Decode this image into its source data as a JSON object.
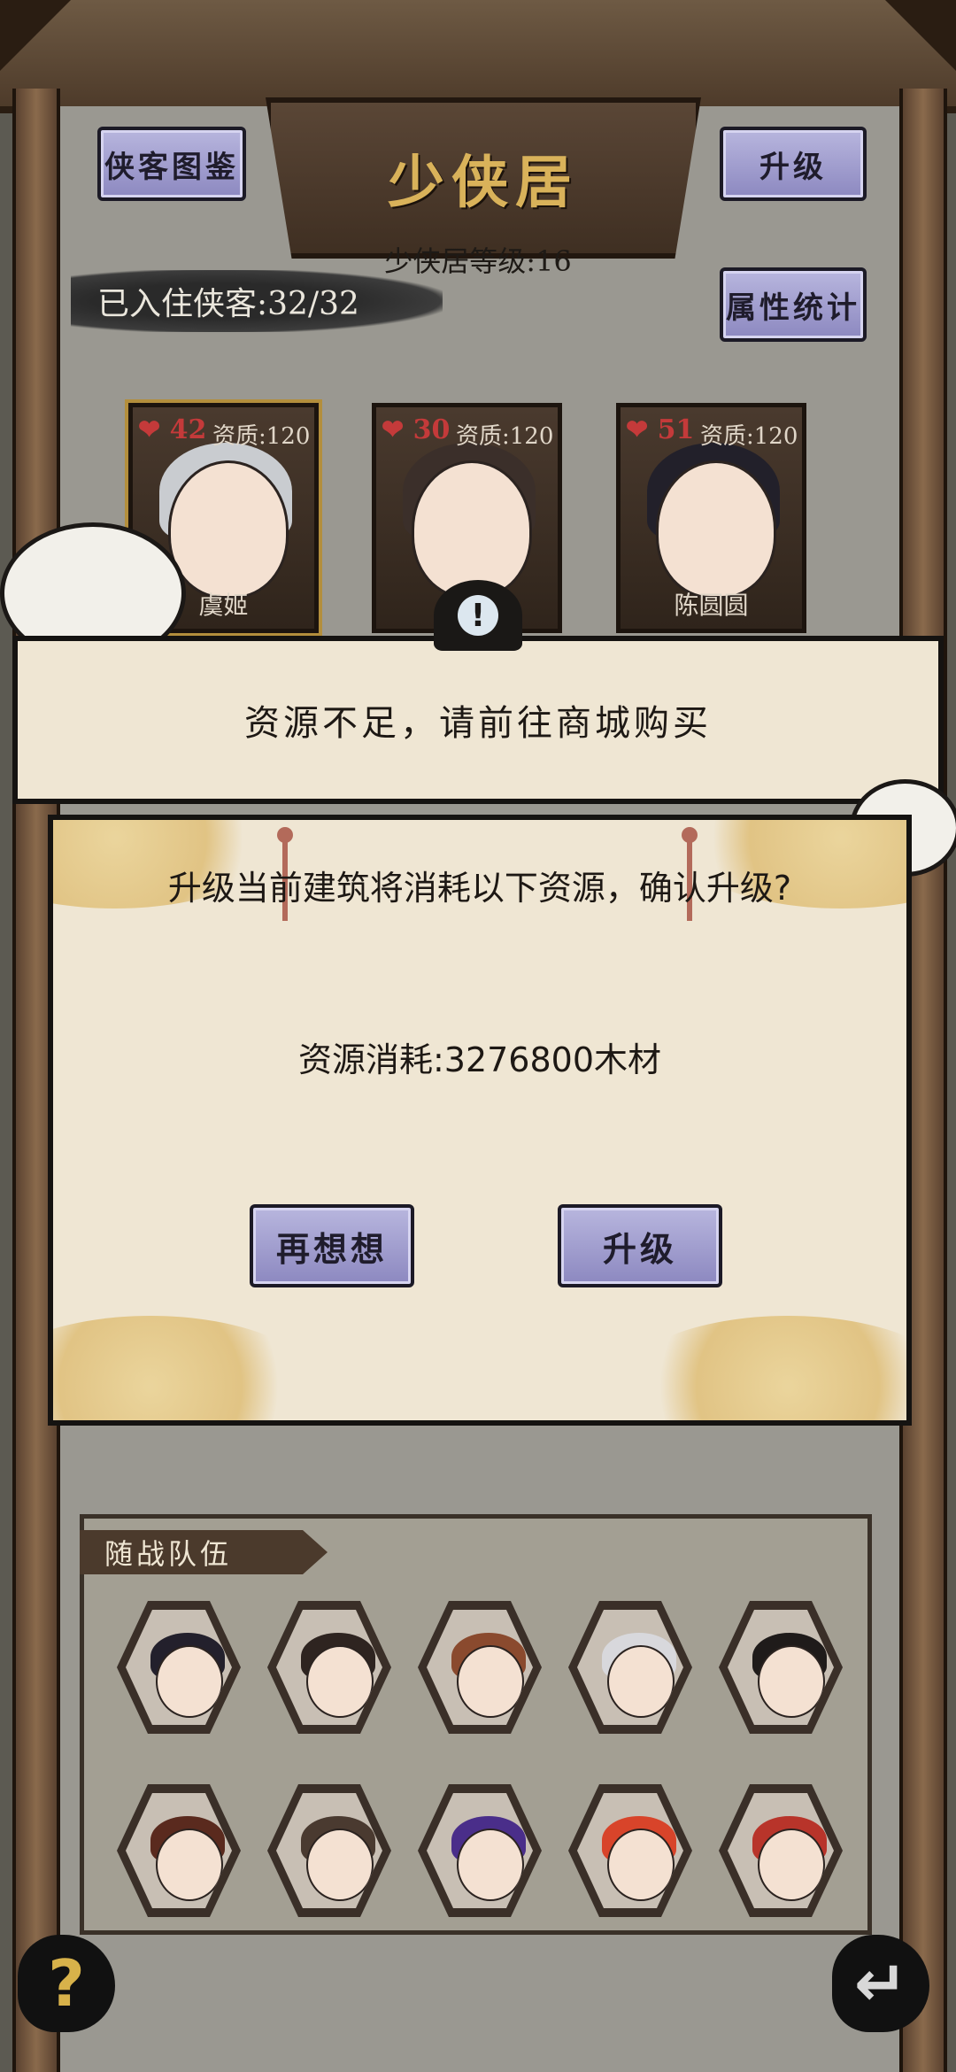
{
  "building": {
    "title": "少侠居",
    "level_text": "少侠居等级:16",
    "residents_text": "已入住侠客:32/32"
  },
  "buttons": {
    "codex": "侠客图鉴",
    "upgrade": "升级",
    "stats": "属性统计"
  },
  "heroes": [
    {
      "hp": "42",
      "aptitude": "资质:120",
      "name": "虞姬",
      "hair_color": "#c9ccd0"
    },
    {
      "hp": "30",
      "aptitude": "资质:120",
      "name": "",
      "hair_color": "#3b2f2a"
    },
    {
      "hp": "51",
      "aptitude": "资质:120",
      "name": "陈圆圆",
      "hair_color": "#22202a"
    }
  ],
  "dialog": {
    "badge_icon": "!",
    "title": "资源不足，请前往商城购买",
    "message": "升级当前建筑将消耗以下资源，确认升级?",
    "cost": "资源消耗:3276800木材",
    "cancel_label": "再想想",
    "confirm_label": "升级"
  },
  "team": {
    "label": "随战队伍",
    "members": [
      {
        "hair": "#23202c"
      },
      {
        "hair": "#2e2420"
      },
      {
        "hair": "#8a4a2e"
      },
      {
        "hair": "#d8d8dc"
      },
      {
        "hair": "#1f1b1a"
      },
      {
        "hair": "#5a2a1e"
      },
      {
        "hair": "#4a3a30"
      },
      {
        "hair": "#4a2e8a"
      },
      {
        "hair": "#d8442a"
      },
      {
        "hair": "#b8342a"
      }
    ]
  },
  "corners": {
    "help_icon": "?",
    "back_icon": "↵"
  }
}
